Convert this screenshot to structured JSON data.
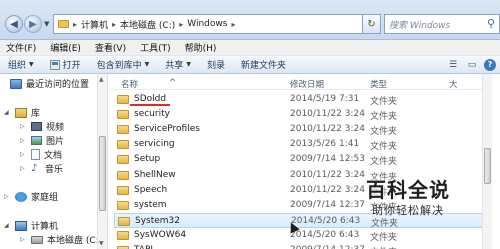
{
  "address": {
    "crumbs": [
      "计算机",
      "本地磁盘 (C:)",
      "Windows"
    ],
    "search_placeholder": "搜索 Windows"
  },
  "menu": [
    "文件(F)",
    "编辑(E)",
    "查看(V)",
    "工具(T)",
    "帮助(H)"
  ],
  "toolbar": {
    "organize": "组织",
    "open": "打开",
    "include_in_library": "包含到库中",
    "share": "共享",
    "burn": "刻录",
    "new_folder": "新建文件夹"
  },
  "nav": {
    "recent": "最近访问的位置",
    "library": "库",
    "videos": "视频",
    "pictures": "图片",
    "documents": "文档",
    "music": "音乐",
    "homegroup": "家庭组",
    "computer": "计算机",
    "local_disk": "本地磁盘 (C:)"
  },
  "columns": {
    "name": "名称",
    "date_modified": "修改日期",
    "type": "类型",
    "size": "大"
  },
  "files": [
    {
      "name": "SDoldd",
      "date": "2014/5/19 7:31",
      "type": "文件夹"
    },
    {
      "name": "security",
      "date": "2010/11/22 3:24",
      "type": "文件夹"
    },
    {
      "name": "ServiceProfiles",
      "date": "2010/11/22 3:24",
      "type": "文件夹"
    },
    {
      "name": "servicing",
      "date": "2013/5/26 1:41",
      "type": "文件夹"
    },
    {
      "name": "Setup",
      "date": "2009/7/14 12:53",
      "type": "文件夹"
    },
    {
      "name": "ShellNew",
      "date": "2010/11/22 3:24",
      "type": "文件夹"
    },
    {
      "name": "Speech",
      "date": "2010/11/22 3:24",
      "type": "文件夹"
    },
    {
      "name": "system",
      "date": "2009/7/14 12:37",
      "type": "文件夹"
    },
    {
      "name": "System32",
      "date": "2014/5/20 6:43",
      "type": "文件夹"
    },
    {
      "name": "SysWOW64",
      "date": "2014/5/20 6:43",
      "type": "文件夹"
    },
    {
      "name": "TAPI",
      "date": "2009/7/14 12:37",
      "type": "文件夹"
    }
  ],
  "watermark": {
    "title": "百科全说",
    "subtitle": "助你轻松解决"
  }
}
